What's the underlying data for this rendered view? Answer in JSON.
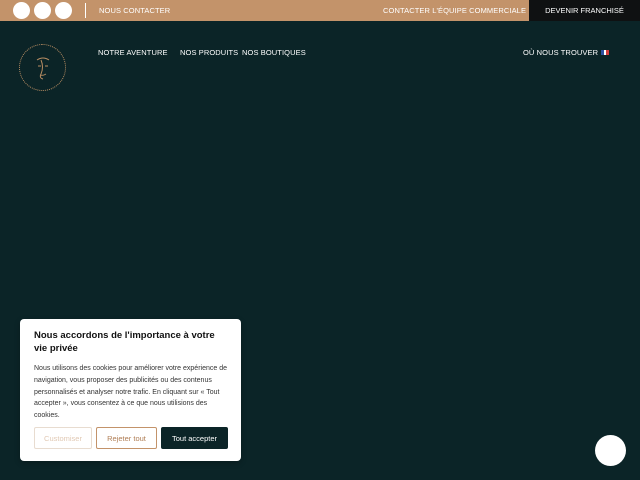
{
  "topbar": {
    "contact_label": "NOUS CONTACTER",
    "contact_team_label": "CONTACTER L'ÉQUIPE COMMERCIALE",
    "franchise_label": "DEVENIR FRANCHISÉ"
  },
  "nav": {
    "items": [
      {
        "label": "NOTRE AVENTURE"
      },
      {
        "label": "NOS PRODUITS"
      },
      {
        "label": "NOS BOUTIQUES"
      }
    ],
    "where_label": "OÙ NOUS TROUVER",
    "language_flag": "fr-flag-icon"
  },
  "cookie": {
    "title": "Nous accordons de l'importance à votre vie privée",
    "body": "Nous utilisons des cookies pour améliorer votre expérience de navigation, vous proposer des publicités ou des contenus personnalisés et analyser notre trafic. En cliquant sur « Tout accepter », vous consentez à ce que nous utilisions des cookies.",
    "customize_label": "Customiser",
    "reject_label": "Rejeter tout",
    "accept_label": "Tout accepter"
  },
  "colors": {
    "background": "#0b2427",
    "accent": "#c3936a",
    "dark": "#0f1112"
  }
}
